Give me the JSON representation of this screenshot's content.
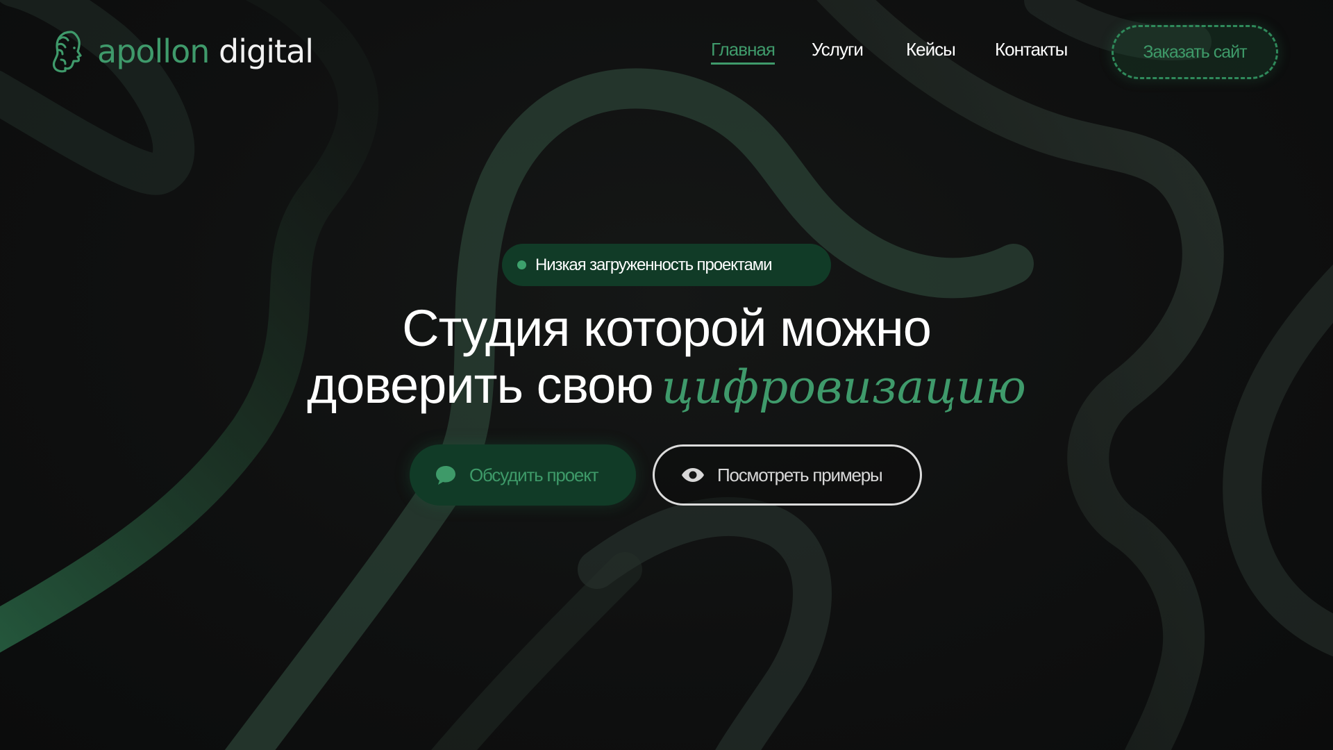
{
  "brand": {
    "name_part1": "apollon",
    "name_part2": " digital",
    "logo_icon": "apollo-head-icon"
  },
  "nav": {
    "items": [
      {
        "label": "Главная",
        "active": true
      },
      {
        "label": "Услуги",
        "active": false
      },
      {
        "label": "Кейсы",
        "active": false
      },
      {
        "label": "Контакты",
        "active": false
      }
    ],
    "cta_label": "Заказать сайт"
  },
  "hero": {
    "badge_text": "Низкая загруженность проектами",
    "headline_line1": "Студия которой можно",
    "headline_line2": "доверить свою",
    "headline_script": "цифровизацию",
    "primary_button": {
      "label": "Обсудить проект",
      "icon": "chat-bubble-icon"
    },
    "secondary_button": {
      "label": "Посмотреть примеры",
      "icon": "eye-icon"
    }
  },
  "colors": {
    "background": "#0f1010",
    "accent": "#3f9a6b",
    "accent_dark": "#113b27",
    "text": "#ffffff"
  }
}
